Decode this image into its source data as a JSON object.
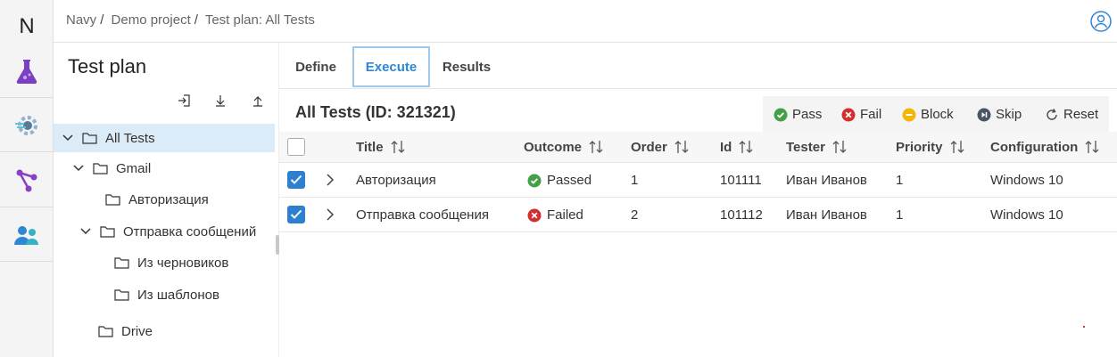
{
  "app": {
    "logo_letter": "N"
  },
  "rail": [
    {
      "name": "test-plans-flask-icon",
      "color": "#7b3fc4"
    },
    {
      "name": "settings-gear-icon",
      "color": "#6aa8d8"
    },
    {
      "name": "pipeline-branch-icon",
      "color": "#8a3fc4"
    },
    {
      "name": "users-group-icon",
      "color": "#2f86d4"
    }
  ],
  "breadcrumb": [
    {
      "label": "Navy"
    },
    {
      "label": "Demo project"
    },
    {
      "label": "Test plan: All Tests"
    }
  ],
  "tree": {
    "title": "Test plan",
    "tools": [
      {
        "name": "import-icon"
      },
      {
        "name": "download-icon"
      },
      {
        "name": "upload-icon"
      }
    ],
    "items": [
      {
        "label": "All Tests",
        "expanded": true,
        "selected": true
      },
      {
        "label": "Gmail",
        "expanded": true
      },
      {
        "label": "Авторизация"
      },
      {
        "label": "Отправка сообщений",
        "expanded": true
      },
      {
        "label": "Из черновиков"
      },
      {
        "label": "Из шаблонов"
      },
      {
        "label": "Drive"
      }
    ]
  },
  "tabs": [
    {
      "label": "Define",
      "active": false
    },
    {
      "label": "Execute",
      "active": true
    },
    {
      "label": "Results",
      "active": false
    }
  ],
  "section": {
    "title": "All Tests (ID: 321321)"
  },
  "actions": [
    {
      "label": "Pass",
      "icon": "pass-check-icon",
      "color": "#43a047"
    },
    {
      "label": "Fail",
      "icon": "fail-x-icon",
      "color": "#d32f2f"
    },
    {
      "label": "Block",
      "icon": "block-minus-icon",
      "color": "#f2b705"
    },
    {
      "label": "Skip",
      "icon": "skip-forward-icon",
      "color": "#4a5560"
    },
    {
      "label": "Reset",
      "icon": "reset-arrow-icon",
      "color": "#444444"
    }
  ],
  "table": {
    "columns": [
      "Title",
      "Outcome",
      "Order",
      "Id",
      "Tester",
      "Priority",
      "Configuration"
    ],
    "rows": [
      {
        "checked": true,
        "title": "Авторизация",
        "outcome": "Passed",
        "outcome_color": "#43a047",
        "order": "1",
        "id": "101111",
        "tester": "Иван Иванов",
        "priority": "1",
        "configuration": "Windows 10"
      },
      {
        "checked": true,
        "title": "Отправка сообщения",
        "outcome": "Failed",
        "outcome_color": "#d32f2f",
        "order": "2",
        "id": "101112",
        "tester": "Иван Иванов",
        "priority": "1",
        "configuration": "Windows 10"
      }
    ]
  }
}
